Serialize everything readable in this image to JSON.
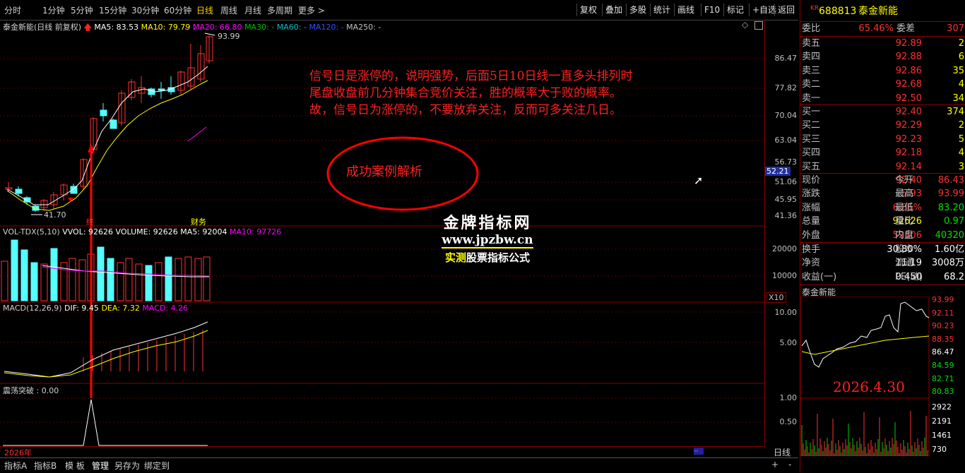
{
  "toolbar": {
    "periods": [
      "分时",
      "1分钟",
      "5分钟",
      "15分钟",
      "30分钟",
      "60分钟",
      "日线",
      "周线",
      "月线",
      "多周期",
      "更多 >"
    ],
    "active_period": "日线",
    "right_buttons": [
      "复权",
      "叠加",
      "多股",
      "统计",
      "画线",
      "F10",
      "标记",
      "+自选",
      "返回"
    ]
  },
  "chart_header": {
    "name": "泰金新能(日线 前复权)",
    "ma5": "MA5: 83.53",
    "ma10": "MA10: 79.79",
    "ma20": "MA20: 66.80",
    "ma30": "MA30: -",
    "ma60": "MA60: -",
    "ma120": "MA120: -",
    "ma250": "MA250: -",
    "high_label": "93.99",
    "low_label": "41.70",
    "marker_left": "终",
    "marker_finance": "财务"
  },
  "price_axis": [
    "86.47",
    "77.82",
    "70.04",
    "63.04",
    "56.73",
    "52.21",
    "51.06",
    "45.95",
    "41.36"
  ],
  "volume": {
    "header_name": "VOL-TDX(5,10)",
    "vvol": "VVOL: 92626",
    "volume": "VOLUME: 92626",
    "ma5": "MA5: 92004",
    "ma10": "MA10: 97726",
    "axis": [
      "20000",
      "10000"
    ],
    "unit": "X10"
  },
  "macd": {
    "header": "MACD(12,26,9)",
    "dif": "DIF: 9.45",
    "dea": "DEA: 7.32",
    "macd": "MACD: 4.26",
    "axis": [
      "10.00",
      "5.00"
    ]
  },
  "shake": {
    "header": "震荡突破 : 0.00",
    "axis": [
      "1.00",
      "0.50"
    ]
  },
  "year_label": "2026年",
  "period_label": "日线",
  "annotation": {
    "lines": [
      "信号日是涨停的，说明强势，后面5日10日线一直多头排列时",
      "尾盘收盘前几分钟集合竞价关注，胜的概率大于败的概率。",
      "故，信号日为涨停的，不要放弃关注，反而可多关注几日。"
    ],
    "circle_text": "成功案例解析"
  },
  "watermark": {
    "line1": "金牌指标网",
    "line2": "www.jpzbw.cn",
    "line3a": "实测",
    "line3b": "股票指标公式"
  },
  "quote": {
    "badge": "KR",
    "code": "688813",
    "name": "泰金新能",
    "weibi_label": "委比",
    "weibi": "65.46%",
    "weicha_label": "委差",
    "weicha": "307",
    "asks": [
      {
        "label": "卖五",
        "price": "92.89",
        "vol": "2"
      },
      {
        "label": "卖四",
        "price": "92.88",
        "vol": "6"
      },
      {
        "label": "卖三",
        "price": "92.86",
        "vol": "35"
      },
      {
        "label": "卖二",
        "price": "92.68",
        "vol": "4"
      },
      {
        "label": "卖一",
        "price": "92.50",
        "vol": "34"
      }
    ],
    "bids": [
      {
        "label": "买一",
        "price": "92.40",
        "vol": "374"
      },
      {
        "label": "买二",
        "price": "92.29",
        "vol": "2"
      },
      {
        "label": "买三",
        "price": "92.23",
        "vol": "5"
      },
      {
        "label": "买四",
        "price": "92.18",
        "vol": "4"
      },
      {
        "label": "买五",
        "price": "92.14",
        "vol": "3"
      }
    ],
    "stats": [
      {
        "l1": "现价",
        "v1": "92.40",
        "l2": "今开",
        "v2": "86.43",
        "c1": "red",
        "c2": "red"
      },
      {
        "l1": "涨跌",
        "v1": "5.93",
        "l2": "最高",
        "v2": "93.99",
        "c1": "red",
        "c2": "red"
      },
      {
        "l1": "涨幅",
        "v1": "6.86%",
        "l2": "最低",
        "v2": "83.20",
        "c1": "red",
        "c2": "green"
      },
      {
        "l1": "总量",
        "v1": "92626",
        "l2": "量比",
        "v2": "0.97",
        "c1": "yellow",
        "c2": "green"
      },
      {
        "l1": "外盘",
        "v1": "52306",
        "l2": "内盘",
        "v2": "40320",
        "c1": "red",
        "c2": "green"
      }
    ],
    "stats2": [
      {
        "l1": "换手",
        "v1": "30.80%",
        "l2": "股本",
        "v2": "1.60亿"
      },
      {
        "l1": "净资",
        "v1": "11.19",
        "l2": "流通",
        "v2": "3008万"
      },
      {
        "l1": "收益(一)",
        "v1": "0.450",
        "l2": "PE(动)",
        "v2": "68.2"
      }
    ],
    "mini_title": "泰金新能",
    "mini_axis": [
      "93.99",
      "92.11",
      "90.23",
      "88.35",
      "86.47",
      "84.59",
      "82.71",
      "80.83"
    ],
    "mini_vol_axis": [
      "2922",
      "2191",
      "1461",
      "730"
    ],
    "mini_date": "2026.4.30"
  },
  "bottom_tabs": [
    "指标A",
    "指标B",
    "模 板",
    "管理",
    "另存为",
    "绑定到"
  ]
}
